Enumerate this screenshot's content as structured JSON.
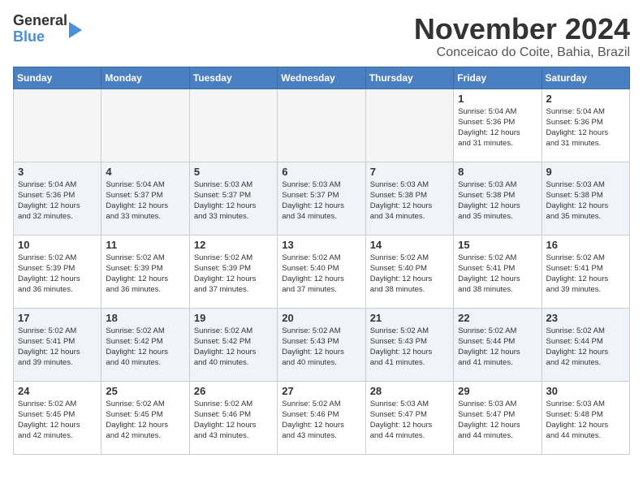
{
  "header": {
    "logo_line1": "General",
    "logo_line2": "Blue",
    "month": "November 2024",
    "location": "Conceicao do Coite, Bahia, Brazil"
  },
  "weekdays": [
    "Sunday",
    "Monday",
    "Tuesday",
    "Wednesday",
    "Thursday",
    "Friday",
    "Saturday"
  ],
  "weeks": [
    [
      {
        "day": "",
        "info": ""
      },
      {
        "day": "",
        "info": ""
      },
      {
        "day": "",
        "info": ""
      },
      {
        "day": "",
        "info": ""
      },
      {
        "day": "",
        "info": ""
      },
      {
        "day": "1",
        "info": "Sunrise: 5:04 AM\nSunset: 5:36 PM\nDaylight: 12 hours\nand 31 minutes."
      },
      {
        "day": "2",
        "info": "Sunrise: 5:04 AM\nSunset: 5:36 PM\nDaylight: 12 hours\nand 31 minutes."
      }
    ],
    [
      {
        "day": "3",
        "info": "Sunrise: 5:04 AM\nSunset: 5:36 PM\nDaylight: 12 hours\nand 32 minutes."
      },
      {
        "day": "4",
        "info": "Sunrise: 5:04 AM\nSunset: 5:37 PM\nDaylight: 12 hours\nand 33 minutes."
      },
      {
        "day": "5",
        "info": "Sunrise: 5:03 AM\nSunset: 5:37 PM\nDaylight: 12 hours\nand 33 minutes."
      },
      {
        "day": "6",
        "info": "Sunrise: 5:03 AM\nSunset: 5:37 PM\nDaylight: 12 hours\nand 34 minutes."
      },
      {
        "day": "7",
        "info": "Sunrise: 5:03 AM\nSunset: 5:38 PM\nDaylight: 12 hours\nand 34 minutes."
      },
      {
        "day": "8",
        "info": "Sunrise: 5:03 AM\nSunset: 5:38 PM\nDaylight: 12 hours\nand 35 minutes."
      },
      {
        "day": "9",
        "info": "Sunrise: 5:03 AM\nSunset: 5:38 PM\nDaylight: 12 hours\nand 35 minutes."
      }
    ],
    [
      {
        "day": "10",
        "info": "Sunrise: 5:02 AM\nSunset: 5:39 PM\nDaylight: 12 hours\nand 36 minutes."
      },
      {
        "day": "11",
        "info": "Sunrise: 5:02 AM\nSunset: 5:39 PM\nDaylight: 12 hours\nand 36 minutes."
      },
      {
        "day": "12",
        "info": "Sunrise: 5:02 AM\nSunset: 5:39 PM\nDaylight: 12 hours\nand 37 minutes."
      },
      {
        "day": "13",
        "info": "Sunrise: 5:02 AM\nSunset: 5:40 PM\nDaylight: 12 hours\nand 37 minutes."
      },
      {
        "day": "14",
        "info": "Sunrise: 5:02 AM\nSunset: 5:40 PM\nDaylight: 12 hours\nand 38 minutes."
      },
      {
        "day": "15",
        "info": "Sunrise: 5:02 AM\nSunset: 5:41 PM\nDaylight: 12 hours\nand 38 minutes."
      },
      {
        "day": "16",
        "info": "Sunrise: 5:02 AM\nSunset: 5:41 PM\nDaylight: 12 hours\nand 39 minutes."
      }
    ],
    [
      {
        "day": "17",
        "info": "Sunrise: 5:02 AM\nSunset: 5:41 PM\nDaylight: 12 hours\nand 39 minutes."
      },
      {
        "day": "18",
        "info": "Sunrise: 5:02 AM\nSunset: 5:42 PM\nDaylight: 12 hours\nand 40 minutes."
      },
      {
        "day": "19",
        "info": "Sunrise: 5:02 AM\nSunset: 5:42 PM\nDaylight: 12 hours\nand 40 minutes."
      },
      {
        "day": "20",
        "info": "Sunrise: 5:02 AM\nSunset: 5:43 PM\nDaylight: 12 hours\nand 40 minutes."
      },
      {
        "day": "21",
        "info": "Sunrise: 5:02 AM\nSunset: 5:43 PM\nDaylight: 12 hours\nand 41 minutes."
      },
      {
        "day": "22",
        "info": "Sunrise: 5:02 AM\nSunset: 5:44 PM\nDaylight: 12 hours\nand 41 minutes."
      },
      {
        "day": "23",
        "info": "Sunrise: 5:02 AM\nSunset: 5:44 PM\nDaylight: 12 hours\nand 42 minutes."
      }
    ],
    [
      {
        "day": "24",
        "info": "Sunrise: 5:02 AM\nSunset: 5:45 PM\nDaylight: 12 hours\nand 42 minutes."
      },
      {
        "day": "25",
        "info": "Sunrise: 5:02 AM\nSunset: 5:45 PM\nDaylight: 12 hours\nand 42 minutes."
      },
      {
        "day": "26",
        "info": "Sunrise: 5:02 AM\nSunset: 5:46 PM\nDaylight: 12 hours\nand 43 minutes."
      },
      {
        "day": "27",
        "info": "Sunrise: 5:02 AM\nSunset: 5:46 PM\nDaylight: 12 hours\nand 43 minutes."
      },
      {
        "day": "28",
        "info": "Sunrise: 5:03 AM\nSunset: 5:47 PM\nDaylight: 12 hours\nand 44 minutes."
      },
      {
        "day": "29",
        "info": "Sunrise: 5:03 AM\nSunset: 5:47 PM\nDaylight: 12 hours\nand 44 minutes."
      },
      {
        "day": "30",
        "info": "Sunrise: 5:03 AM\nSunset: 5:48 PM\nDaylight: 12 hours\nand 44 minutes."
      }
    ]
  ]
}
